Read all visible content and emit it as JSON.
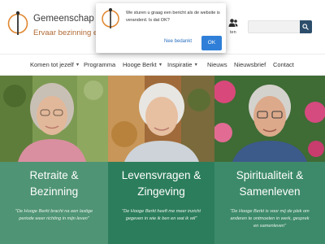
{
  "site": {
    "title": "Gemeenschap D",
    "tagline": "Ervaar bezinning en ve"
  },
  "header": {
    "user_label": "ten",
    "search_placeholder": ""
  },
  "nav": {
    "items": [
      {
        "label": "Komen tot jezelf",
        "has_dropdown": true
      },
      {
        "label": "Programma",
        "has_dropdown": false
      },
      {
        "label": "Hooge Berkt",
        "has_dropdown": true
      },
      {
        "label": "Inspiratie",
        "has_dropdown": true
      },
      {
        "label": "Nieuws",
        "has_dropdown": false
      },
      {
        "label": "Nieuwsbrief",
        "has_dropdown": false
      },
      {
        "label": "Contact",
        "has_dropdown": false
      }
    ]
  },
  "cookie": {
    "line1": "We sturen u graag een bericht als de website is",
    "line2": "veranderd. Is dat OK?",
    "decline_label": "Nee bedankt",
    "accept_label": "OK"
  },
  "panels": [
    {
      "title_line1": "Retraite &",
      "title_line2": "Bezinning",
      "text_line1": "\"De Hooge Berkt bracht na een lastige",
      "text_line2": "periode weer richting in mijn leven\"",
      "color": "#4f9474"
    },
    {
      "title_line1": "Levensvragen &",
      "title_line2": "Zingeving",
      "text_line1": "\"De Hooge Berkt heeft me meer inzicht",
      "text_line2": "gegeven in wie ik ben en wat ik wil\"",
      "color": "#2c7d5c"
    },
    {
      "title_line1": "Spiritualiteit &",
      "title_line2": "Samenleven",
      "text_line1": "\"De Hooge Berkt is voor mij de plek om",
      "text_line2": "anderen te ontmoeten in werk, gesprek",
      "text_line3": "en samenleven\"",
      "color": "#3d8a6a"
    }
  ],
  "colors": {
    "accent_orange": "#e0862e",
    "search_button": "#2c4e6b",
    "cookie_ok": "#2f7fd8"
  }
}
